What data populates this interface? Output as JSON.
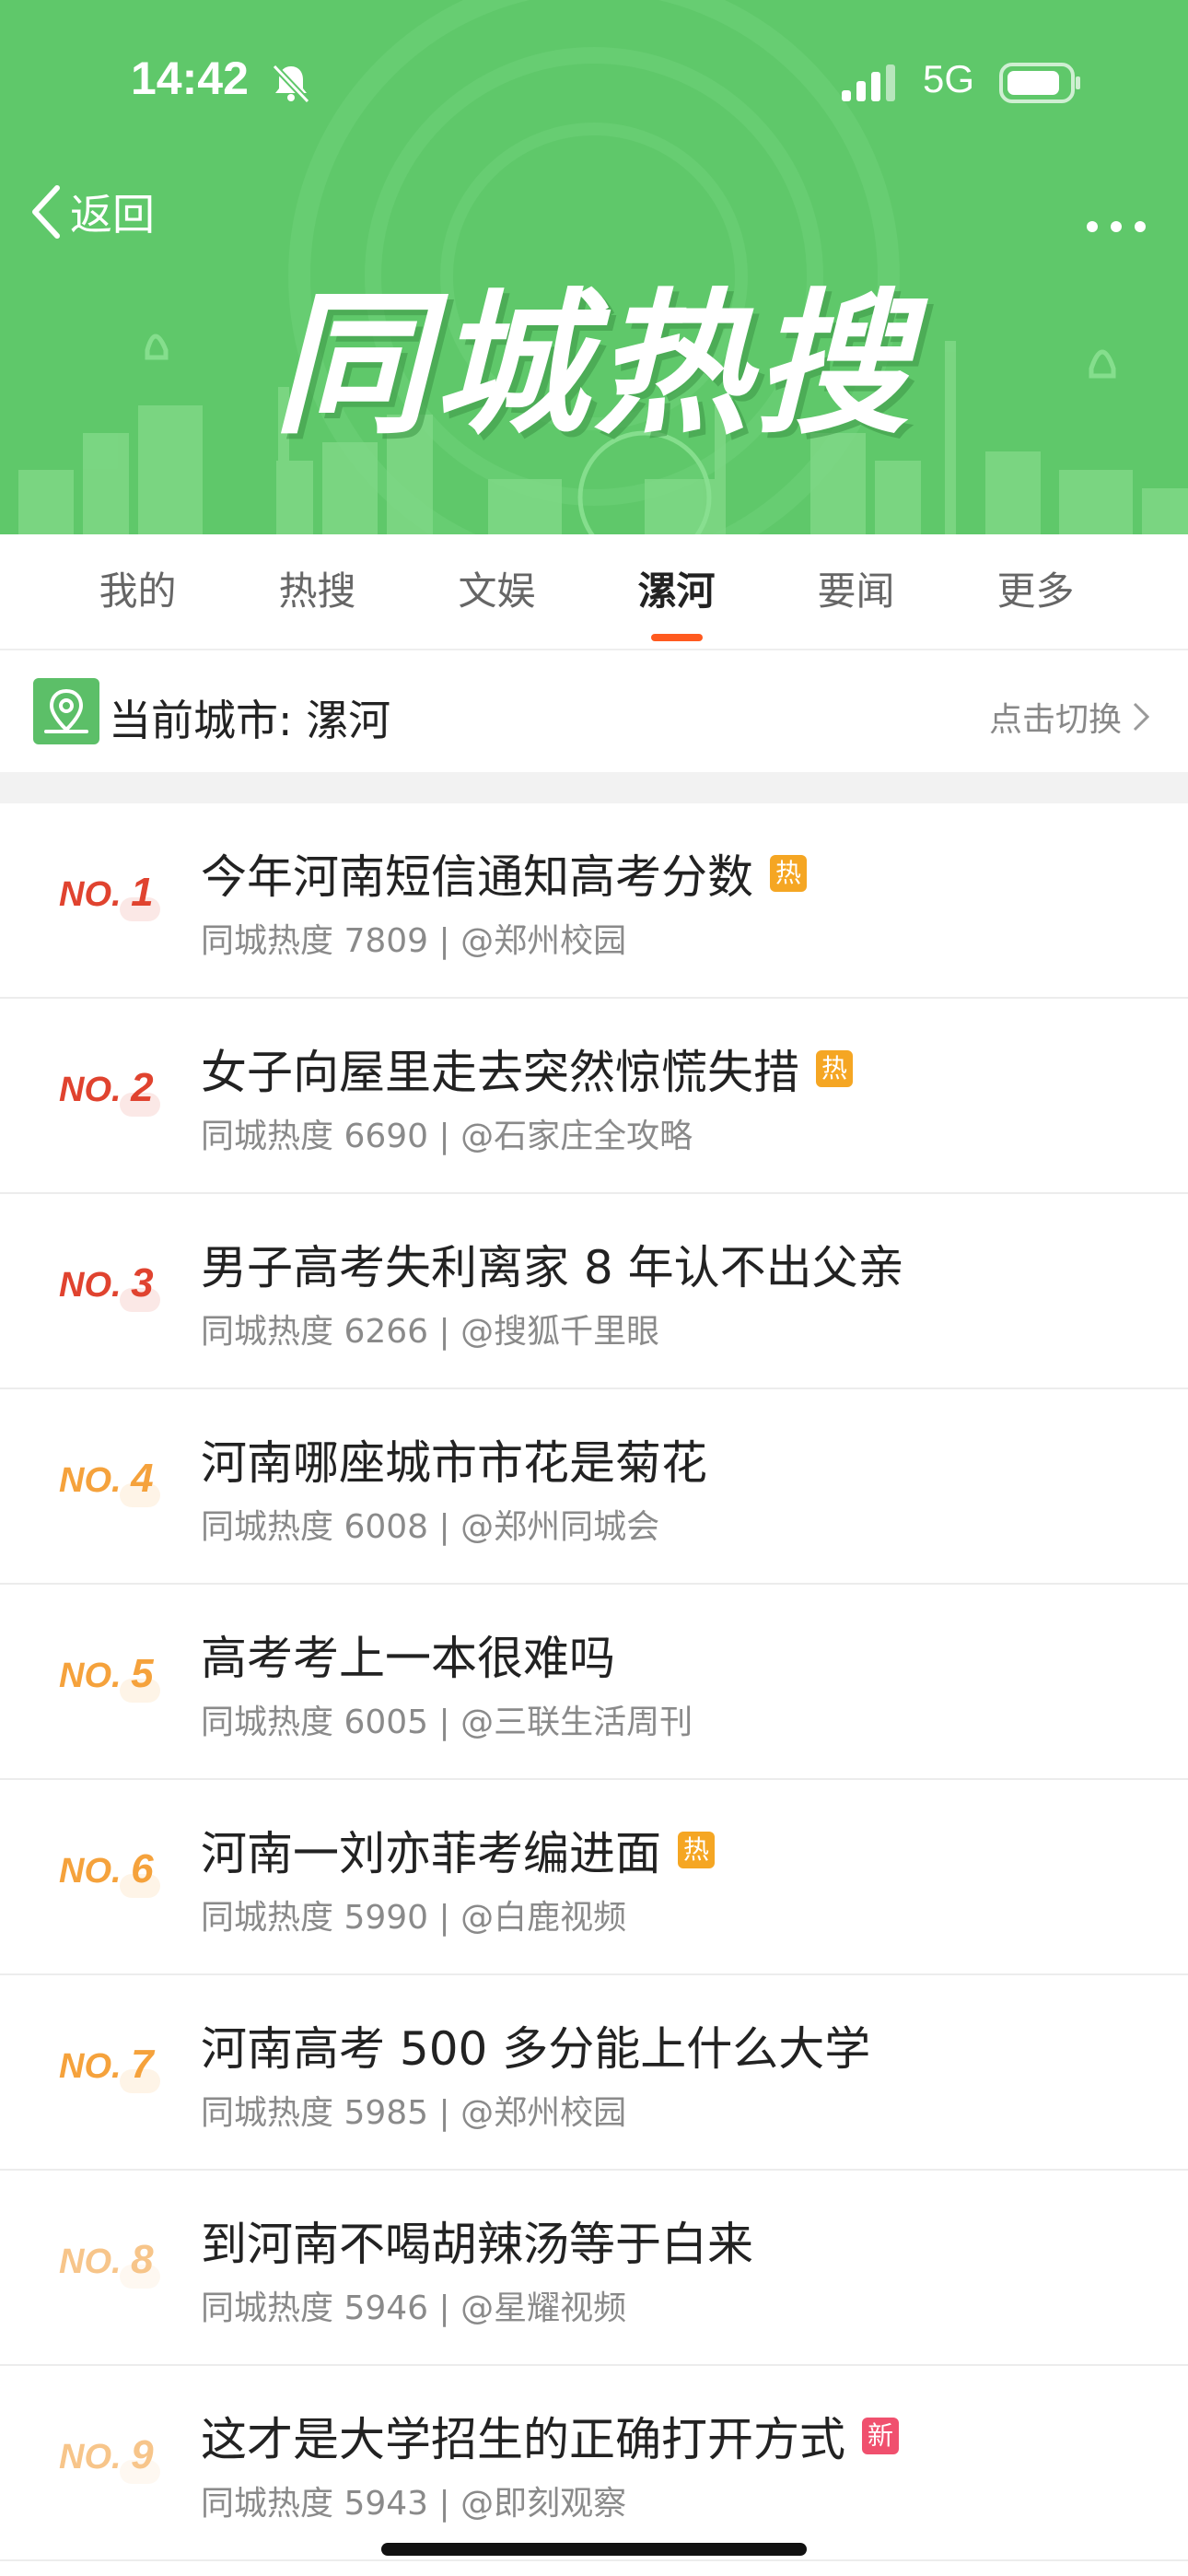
{
  "status": {
    "time": "14:42",
    "network": "5G"
  },
  "nav": {
    "back_label": "返回"
  },
  "hero": {
    "title": "同城热搜"
  },
  "tabs": [
    {
      "label": "我的"
    },
    {
      "label": "热搜"
    },
    {
      "label": "文娱"
    },
    {
      "label": "漯河",
      "active": true
    },
    {
      "label": "要闻"
    },
    {
      "label": "更多"
    }
  ],
  "city": {
    "label": "当前城市: 漯河",
    "switch_label": "点击切换"
  },
  "items": [
    {
      "rank": "1",
      "title": "今年河南短信通知高考分数",
      "badge": "热",
      "meta": "同城热度 7809 | @郑州校园"
    },
    {
      "rank": "2",
      "title": "女子向屋里走去突然惊慌失措",
      "badge": "热",
      "meta": "同城热度 6690 | @石家庄全攻略"
    },
    {
      "rank": "3",
      "title": "男子高考失利离家 8 年认不出父亲",
      "badge": "",
      "meta": "同城热度 6266 | @搜狐千里眼"
    },
    {
      "rank": "4",
      "title": "河南哪座城市市花是菊花",
      "badge": "",
      "meta": "同城热度 6008 | @郑州同城会"
    },
    {
      "rank": "5",
      "title": "高考考上一本很难吗",
      "badge": "",
      "meta": "同城热度 6005 | @三联生活周刊"
    },
    {
      "rank": "6",
      "title": "河南一刘亦菲考编进面",
      "badge": "热",
      "meta": "同城热度 5990 | @白鹿视频"
    },
    {
      "rank": "7",
      "title": "河南高考 500 多分能上什么大学",
      "badge": "",
      "meta": "同城热度 5985 | @郑州校园"
    },
    {
      "rank": "8",
      "title": "到河南不喝胡辣汤等于白来",
      "badge": "",
      "meta": "同城热度 5946 | @星耀视频"
    },
    {
      "rank": "9",
      "title": "这才是大学招生的正确打开方式",
      "badge": "新",
      "meta": "同城热度 5943 | @即刻观察"
    }
  ],
  "colors": {
    "hero_green": "#5fc86a",
    "rank_top": "#e0432f",
    "rank_mid": "#f5a23c",
    "rank_low": "#f7c58a",
    "badge_hot": "#f5a623",
    "badge_new": "#f0506e",
    "tab_accent": "#ff5a1f"
  }
}
